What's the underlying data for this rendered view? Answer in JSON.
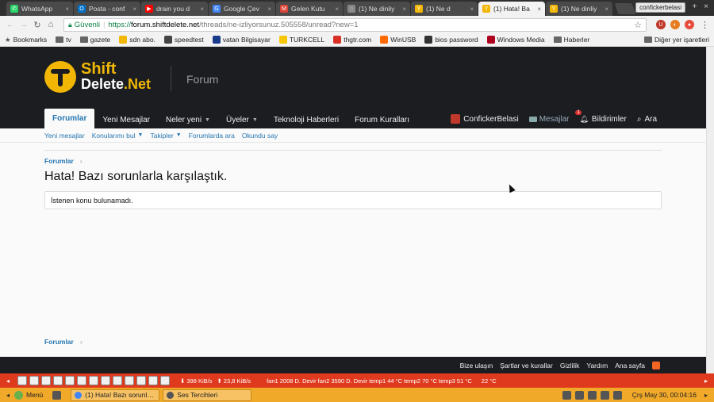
{
  "tabs": [
    {
      "title": "WhatsApp",
      "fav_color": "#25d366",
      "fav_glyph": "✆"
    },
    {
      "title": "Posta - conf",
      "fav_color": "#0072c6",
      "fav_glyph": "O"
    },
    {
      "title": "drain you d",
      "fav_color": "#ff0000",
      "fav_glyph": "▶"
    },
    {
      "title": "Google Çev",
      "fav_color": "#4285f4",
      "fav_glyph": "G"
    },
    {
      "title": "Gelen Kutu",
      "fav_color": "#db4437",
      "fav_glyph": "M"
    },
    {
      "title": "(1) Ne dinliy",
      "fav_color": "#888888",
      "fav_glyph": "◌"
    },
    {
      "title": "(1) Ne d",
      "fav_color": "#f2b705",
      "fav_glyph": "Y"
    },
    {
      "title": "(1) Hata! Ba",
      "fav_color": "#f2b705",
      "fav_glyph": "Y",
      "active": true
    },
    {
      "title": "(1) Ne dinliy",
      "fav_color": "#f2b705",
      "fav_glyph": "Y"
    }
  ],
  "profile_name": "confickerbelasi",
  "window_controls": "– + ×",
  "toolbar": {
    "secure_label": "Güvenli",
    "url_scheme": "https://",
    "url_host": "forum.shiftdelete.net",
    "url_path": "/threads/ne-izliyorsunuz.505558/unread?new=1"
  },
  "bookmarks": {
    "items": [
      {
        "label": "Bookmarks",
        "type": "folder-star"
      },
      {
        "label": "tv",
        "type": "folder"
      },
      {
        "label": "gazete",
        "type": "folder"
      },
      {
        "label": "sdn abo.",
        "type": "site",
        "color": "#f2b705"
      },
      {
        "label": "speedtest",
        "type": "site",
        "color": "#444444"
      },
      {
        "label": "vatan Bilgisayar",
        "type": "site",
        "color": "#1a3a8a"
      },
      {
        "label": "TURKCELL",
        "type": "site",
        "color": "#f7c600"
      },
      {
        "label": "thgtr.com",
        "type": "site",
        "color": "#d93025"
      },
      {
        "label": "WinUSB",
        "type": "site",
        "color": "#ff6a00"
      },
      {
        "label": "bios password",
        "type": "site",
        "color": "#333333"
      },
      {
        "label": "Windows Media",
        "type": "site",
        "color": "#b00020"
      },
      {
        "label": "Haberler",
        "type": "folder"
      }
    ],
    "other": "Diğer yer işaretleri"
  },
  "site": {
    "logo_line1": "Shift",
    "logo_line2a": "Delete",
    "logo_line2b": ".Net",
    "forum_label": "Forum",
    "nav": [
      {
        "label": "Forumlar",
        "active": true,
        "caret": false
      },
      {
        "label": "Yeni Mesajlar",
        "caret": false
      },
      {
        "label": "Neler yeni",
        "caret": true
      },
      {
        "label": "Üyeler",
        "caret": true
      },
      {
        "label": "Teknoloji Haberleri",
        "caret": false
      },
      {
        "label": "Forum Kuralları",
        "caret": false
      }
    ],
    "user": {
      "name": "ConfickerBelasi",
      "messages": "Mesajlar",
      "alerts": "Bildirimler",
      "alerts_count": "1",
      "search": "Ara"
    },
    "subnav": [
      {
        "label": "Yeni mesajlar",
        "caret": false
      },
      {
        "label": "Konularımı bul",
        "caret": true
      },
      {
        "label": "Takipler",
        "caret": true
      },
      {
        "label": "Forumlarda ara",
        "caret": false
      },
      {
        "label": "Okundu say",
        "caret": false
      }
    ]
  },
  "main": {
    "breadcrumb": "Forumlar",
    "title": "Hata! Bazı sorunlarla karşılaştık.",
    "message": "İstenen konu bulunamadı."
  },
  "footer": {
    "links": [
      "Bize ulaşın",
      "Şartlar ve kurallar",
      "Gizlilik",
      "Yardım",
      "Ana sayfa"
    ]
  },
  "syspanel": {
    "net_down": "398 KiB/s",
    "net_up": "23,8 KiB/s",
    "sensors": "fan1 2008 D. Devir fan2 3590 D. Devir temp1 44 °C temp2 70 °C temp3 51 °C",
    "temp": "22 °C"
  },
  "taskbar": {
    "menu_label": "Menü",
    "tasks": [
      {
        "title": "(1) Hata! Bazı sorunla...",
        "color": "#4285f4"
      },
      {
        "title": "Ses Tercihleri",
        "color": "#555555"
      }
    ],
    "clock": "Çrş May 30, 00:04:16"
  }
}
